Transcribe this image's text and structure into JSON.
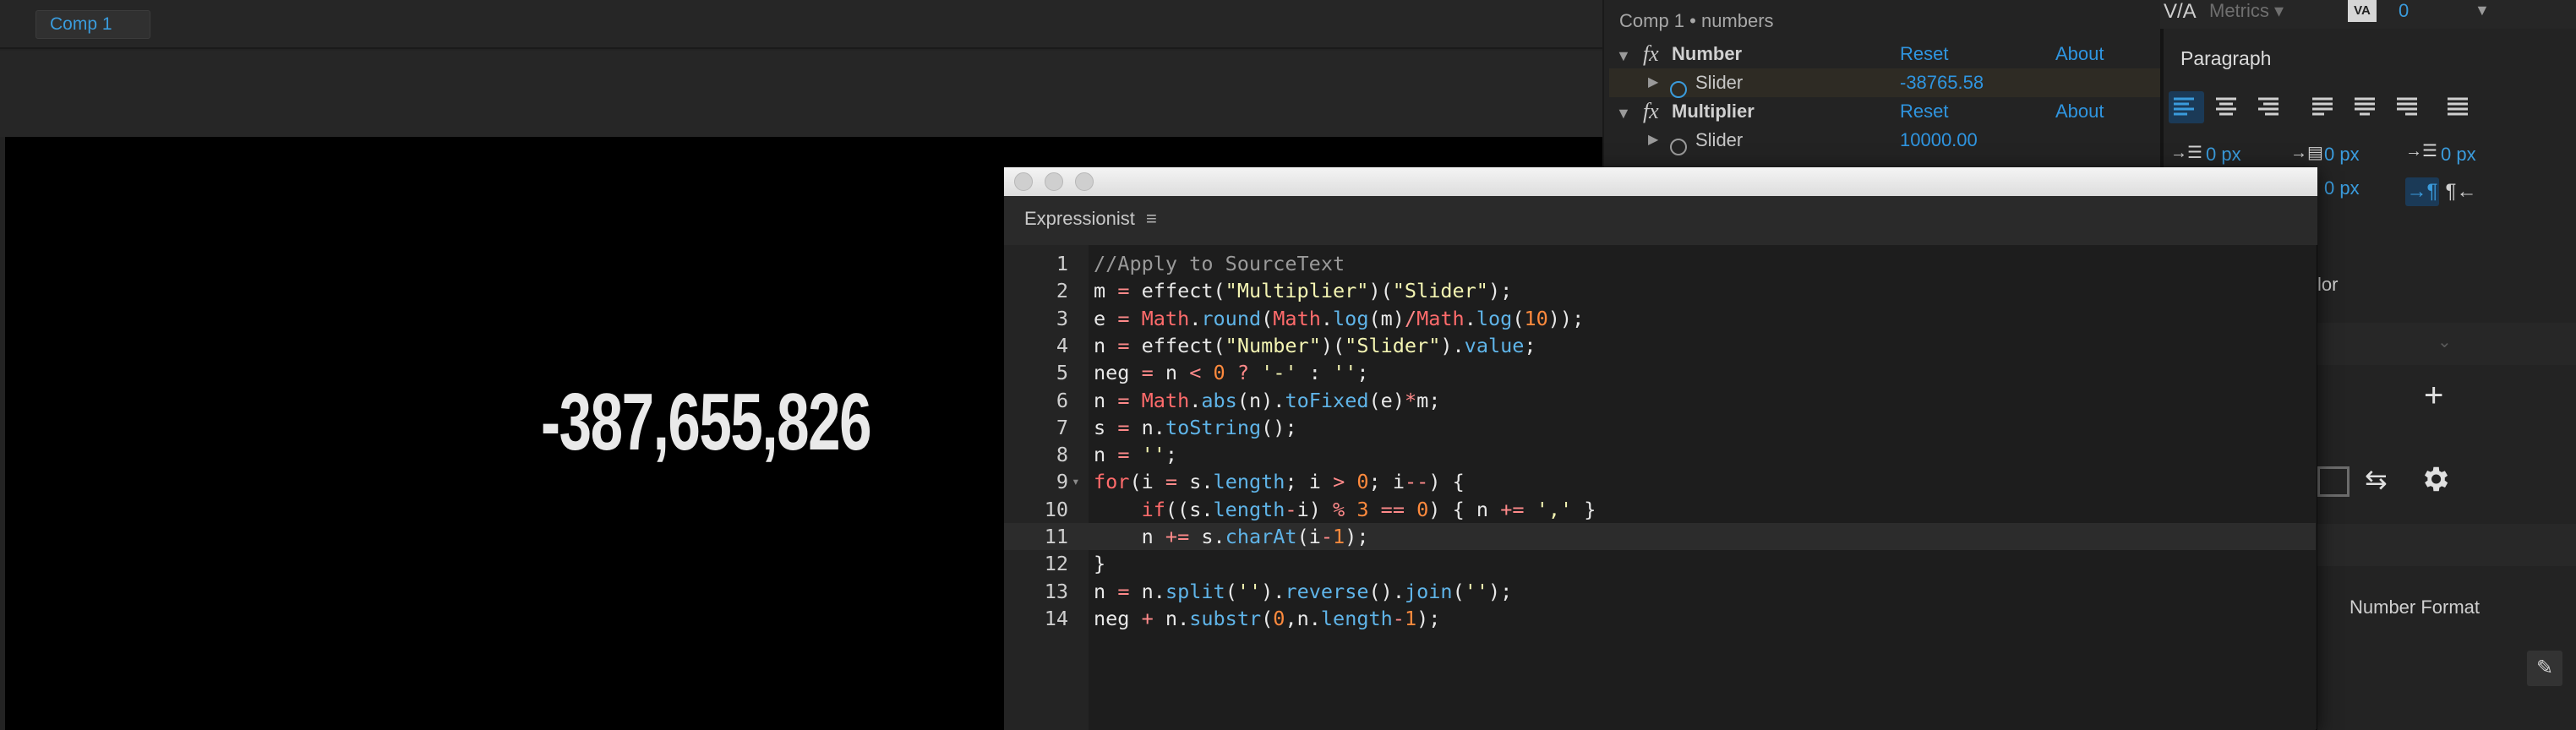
{
  "viewer": {
    "tab_label": "Comp 1",
    "display_number": "-387,655,826"
  },
  "effects": {
    "title": "Comp 1 • numbers",
    "groups": [
      {
        "name": "Number",
        "reset": "Reset",
        "about": "About",
        "param": "Slider",
        "value": "-38765.58"
      },
      {
        "name": "Multiplier",
        "reset": "Reset",
        "about": "About",
        "param": "Slider",
        "value": "10000.00"
      }
    ]
  },
  "character": {
    "kerning_label": "Metrics",
    "tracking_value": "0"
  },
  "paragraph": {
    "title": "Paragraph",
    "indent_left": "0 px",
    "space_before": "0 px",
    "indent_first": "0 px",
    "space_after": "0 px"
  },
  "right_panel": {
    "partial_label": "lor",
    "number_format": "Number Format"
  },
  "expressionist": {
    "window_title": "Expressionist",
    "code": [
      {
        "n": "1",
        "t": "//Apply to SourceText"
      },
      {
        "n": "2",
        "t": "m = effect(\"Multiplier\")(\"Slider\");"
      },
      {
        "n": "3",
        "t": "e = Math.round(Math.log(m)/Math.log(10));"
      },
      {
        "n": "4",
        "t": "n = effect(\"Number\")(\"Slider\").value;"
      },
      {
        "n": "5",
        "t": "neg = n < 0 ? '-' : '';"
      },
      {
        "n": "6",
        "t": "n = Math.abs(n).toFixed(e)*m;"
      },
      {
        "n": "7",
        "t": "s = n.toString();"
      },
      {
        "n": "8",
        "t": "n = '';"
      },
      {
        "n": "9",
        "t": "for(i = s.length; i > 0; i--) {"
      },
      {
        "n": "10",
        "t": "    if((s.length-i) % 3 == 0) { n += ',' }"
      },
      {
        "n": "11",
        "t": "    n += s.charAt(i-1);"
      },
      {
        "n": "12",
        "t": "}"
      },
      {
        "n": "13",
        "t": "n = n.split('').reverse().join('');"
      },
      {
        "n": "14",
        "t": "neg + n.substr(0,n.length-1);"
      }
    ]
  }
}
